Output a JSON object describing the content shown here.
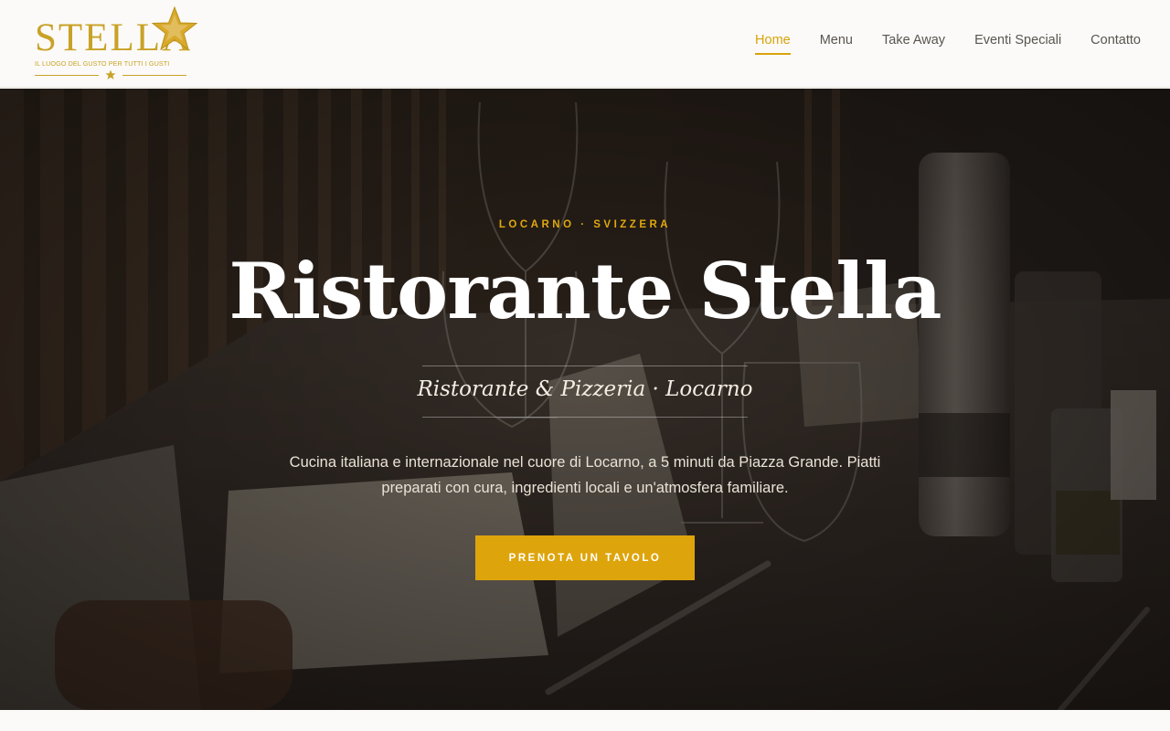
{
  "brand": {
    "logo_word": "STELLA",
    "tagline": "IL LUOGO DEL GUSTO PER TUTTI I GUSTI",
    "accent_color": "#d9a30a",
    "logo_color": "#c9a227"
  },
  "nav": {
    "items": [
      {
        "label": "Home",
        "active": true
      },
      {
        "label": "Menu",
        "active": false
      },
      {
        "label": "Take Away",
        "active": false
      },
      {
        "label": "Eventi Speciali",
        "active": false
      },
      {
        "label": "Contatto",
        "active": false
      }
    ]
  },
  "hero": {
    "kicker": "LOCARNO · SVIZZERA",
    "title": "Ristorante Stella",
    "subtitle": "Ristorante & Pizzeria · Locarno",
    "description": "Cucina italiana e internazionale nel cuore di Locarno, a 5 minuti da Piazza Grande. Piatti preparati con cura, ingredienti locali e un'atmosfera familiare.",
    "cta_label": "PRENOTA UN TAVOLO",
    "cta_color": "#dea40b"
  }
}
